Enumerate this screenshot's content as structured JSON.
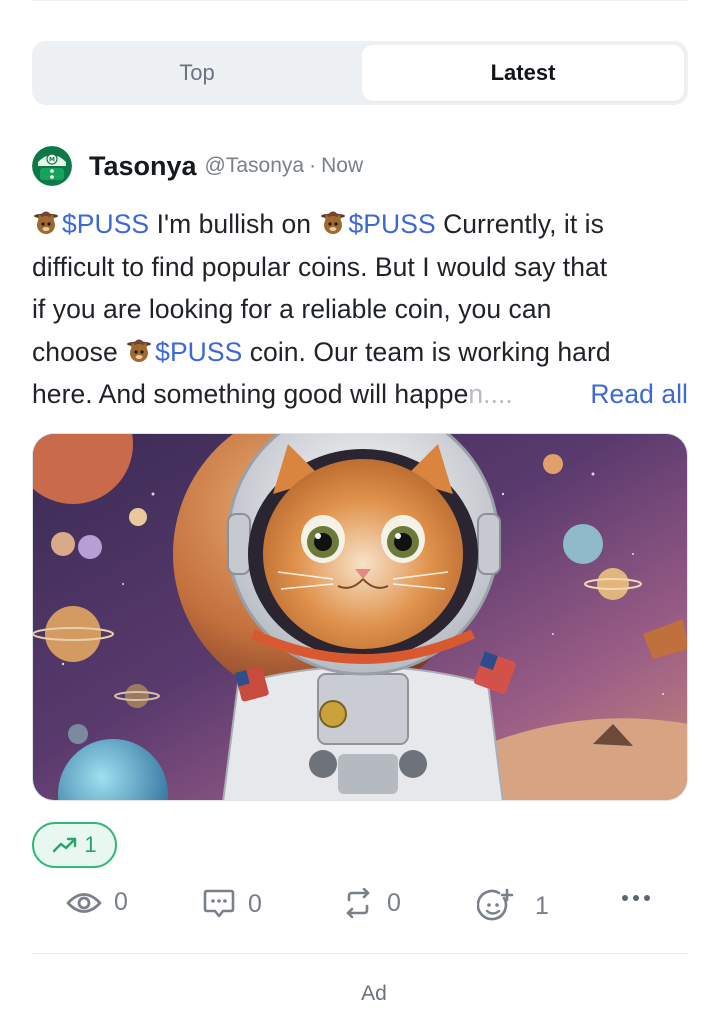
{
  "tabs": [
    {
      "label": "Top",
      "active": false
    },
    {
      "label": "Latest",
      "active": true
    }
  ],
  "post": {
    "author": {
      "name": "Tasonya",
      "handle": "@Tasonya",
      "avatar_icon": "green-pixel-avatar-icon"
    },
    "separator": "·",
    "time": "Now",
    "body": {
      "line1": {
        "ticker1": "$PUSS",
        "text1": " I'm bullish on ",
        "ticker2": "$PUSS",
        "text2": " Currently, it is"
      },
      "line2": "difficult to find popular coins. But I would say that",
      "line3": "if you are looking for a reliable coin, you can",
      "line4": {
        "text1": "choose ",
        "ticker": "$PUSS",
        "text2": " coin. Our team is working hard"
      },
      "line5": {
        "text": "here. And something good will happe",
        "faded": "n....",
        "read_more": "Read all"
      }
    },
    "image": {
      "icon": "astronaut-cat-space-image"
    },
    "trending": {
      "icon": "trending-up-icon",
      "count": "1"
    },
    "actions": {
      "views": "0",
      "comments": "0",
      "reposts": "0",
      "reactions": "1"
    }
  },
  "ad_label": "Ad",
  "colors": {
    "accent": "#3d68d8",
    "trend": "#28a46a"
  }
}
